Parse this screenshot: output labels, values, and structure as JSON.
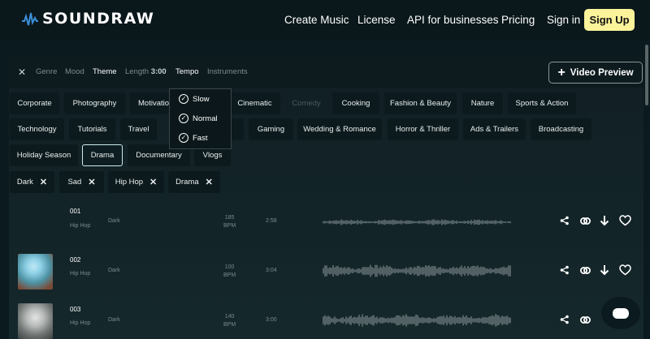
{
  "brand": {
    "name": "SOUNDRAW"
  },
  "nav": {
    "links": [
      "Create Music",
      "License",
      "API for businesses",
      "Pricing",
      "Sign in"
    ],
    "signup": "Sign Up"
  },
  "filterbar": {
    "items": [
      {
        "label": "Genre",
        "active": false
      },
      {
        "label": "Mood",
        "active": false
      },
      {
        "label": "Theme",
        "active": true
      },
      {
        "label": "Length",
        "value": "3:00",
        "active": false
      },
      {
        "label": "Tempo",
        "active": true
      },
      {
        "label": "Instruments",
        "active": false
      }
    ],
    "video_preview": "Video Preview"
  },
  "themes": [
    [
      "Corporate",
      "Photography",
      "Motivation",
      "",
      "Cinematic",
      "Comedy",
      "Cooking",
      "Fashion & Beauty",
      "Nature",
      "Sports & Action"
    ],
    [
      "Technology",
      "Tutorials",
      "Travel",
      "",
      "Vlogs",
      "Gaming",
      "Wedding & Romance",
      "Horror & Thriller",
      "Ads & Trailers",
      "Broadcasting"
    ],
    [
      "Holiday Season",
      "Drama",
      "Documentary",
      "Vlogs"
    ]
  ],
  "tempo_options": [
    "Slow",
    "Normal",
    "Fast"
  ],
  "selected_tags": [
    "Dark",
    "Sad",
    "Hip Hop",
    "Drama"
  ],
  "tracks": [
    {
      "num": "001",
      "genre": "Hip Hop",
      "mood": "Dark",
      "bpm": "185",
      "bpm_unit": "BPM",
      "length": "2:58"
    },
    {
      "num": "002",
      "genre": "Hip Hop",
      "mood": "Dark",
      "bpm": "100",
      "bpm_unit": "BPM",
      "length": "3:04"
    },
    {
      "num": "003",
      "genre": "Hip Hop",
      "mood": "Dark",
      "bpm": "140",
      "bpm_unit": "BPM",
      "length": "3:00"
    }
  ],
  "colors": {
    "accent": "#fbf39a",
    "background": "#0b1a1e"
  },
  "icons": [
    "share-icon",
    "link-icon",
    "download-icon",
    "heart-icon",
    "plus-icon",
    "close-icon",
    "check-circle-icon",
    "chat-icon"
  ]
}
